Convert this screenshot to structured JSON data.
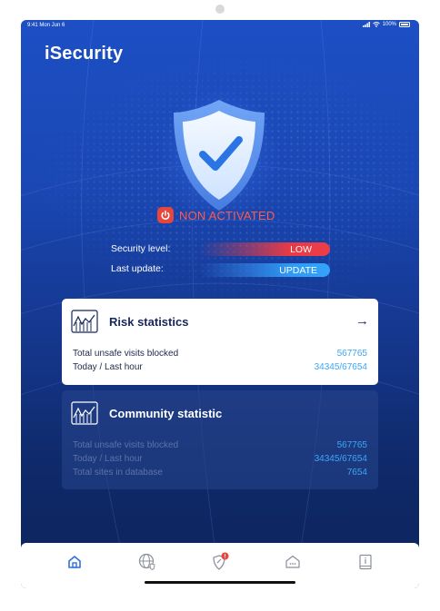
{
  "status_bar": {
    "time": "9:41 Mon Jun 6",
    "battery": "100%"
  },
  "app": {
    "title": "iSecurity"
  },
  "protection": {
    "status": "NON ACTIVATED"
  },
  "security": {
    "level_label": "Security level:",
    "level_value": "LOW",
    "update_label": "Last update:",
    "update_button": "UPDATE"
  },
  "risk_card": {
    "title": "Risk statistics",
    "arrow": "→",
    "rows": [
      {
        "label": "Total unsafe visits blocked",
        "value": "567765"
      },
      {
        "label": "Today / Last hour",
        "value": "34345/67654"
      }
    ]
  },
  "community_card": {
    "title": "Community statistic",
    "rows": [
      {
        "label": "Total unsafe visits blocked",
        "value": "567765"
      },
      {
        "label": "Today / Last hour",
        "value": "34345/67654"
      },
      {
        "label": "Total sites in database",
        "value": "7654"
      }
    ]
  },
  "tabs": [
    {
      "icon": "home-icon",
      "active": true
    },
    {
      "icon": "globe-shield-icon",
      "active": false
    },
    {
      "icon": "alert-shield-icon",
      "active": false
    },
    {
      "icon": "home-more-icon",
      "active": false
    },
    {
      "icon": "info-book-icon",
      "active": false
    }
  ],
  "colors": {
    "accent_blue": "#3da6f6",
    "danger_red": "#e93a45",
    "tab_active": "#2f6fe0",
    "tab_inactive": "#8a8f9a"
  }
}
